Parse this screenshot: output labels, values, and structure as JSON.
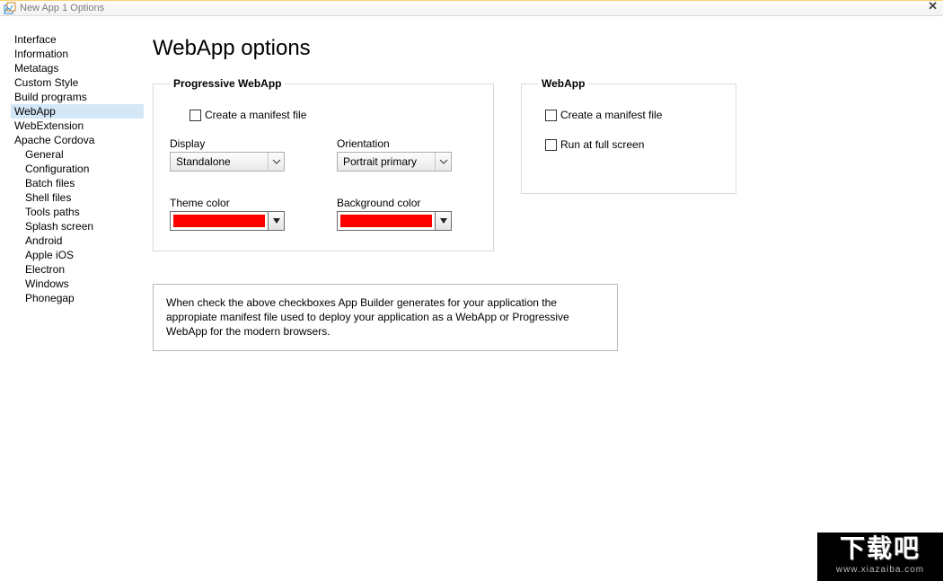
{
  "window": {
    "title": "New App 1 Options",
    "close_glyph": "✕"
  },
  "sidebar": {
    "items": [
      {
        "label": "Interface"
      },
      {
        "label": "Information"
      },
      {
        "label": "Metatags"
      },
      {
        "label": "Custom Style"
      },
      {
        "label": "Build programs"
      },
      {
        "label": "WebApp",
        "selected": true
      },
      {
        "label": "WebExtension"
      },
      {
        "label": "Apache Cordova"
      }
    ],
    "cordova_children": [
      {
        "label": "General"
      },
      {
        "label": "Configuration"
      },
      {
        "label": "Batch files"
      },
      {
        "label": "Shell files"
      },
      {
        "label": "Tools paths"
      },
      {
        "label": "Splash screen"
      },
      {
        "label": "Android"
      },
      {
        "label": "Apple iOS"
      },
      {
        "label": "Electron"
      },
      {
        "label": "Windows"
      },
      {
        "label": "Phonegap"
      }
    ]
  },
  "page": {
    "title": "WebApp options",
    "pwa": {
      "legend": "Progressive WebApp",
      "create_manifest": "Create a manifest file",
      "display_label": "Display",
      "display_value": "Standalone",
      "orientation_label": "Orientation",
      "orientation_value": "Portrait primary",
      "theme_label": "Theme color",
      "theme_color": "#ff0000",
      "bg_label": "Background color",
      "bg_color": "#ff0000"
    },
    "wa": {
      "legend": "WebApp",
      "create_manifest": "Create a manifest file",
      "fullscreen": "Run at full screen"
    },
    "note": "When check the above checkboxes App Builder generates for your application the appropiate manifest file used to deploy your application as a WebApp or Progressive WebApp for the modern browsers."
  },
  "watermark": {
    "line1": "下载吧",
    "line2": "www.xiazaiba.com"
  }
}
